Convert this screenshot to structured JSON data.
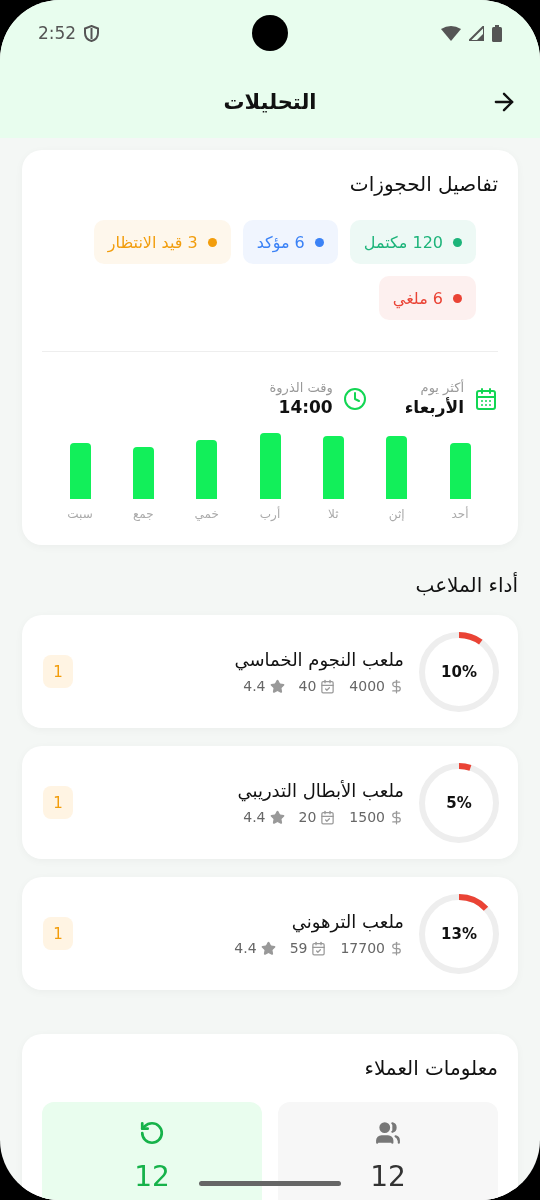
{
  "status_bar": {
    "time": "2:52"
  },
  "header": {
    "title": "التحليلات"
  },
  "bookings": {
    "title": "تفاصيل الحجوزات",
    "chips": [
      {
        "label": "120 مكتمل",
        "color": "#1db47a"
      },
      {
        "label": "6 مؤكد",
        "color": "#3b82f6"
      },
      {
        "label": "3 قيد الانتظار",
        "color": "#f29d0c"
      },
      {
        "label": "6 ملغي",
        "color": "#ea4335"
      }
    ],
    "stats": [
      {
        "kind": "day",
        "label": "أكثر يوم",
        "value": "الأربعاء"
      },
      {
        "kind": "time",
        "label": "وقت الذروة",
        "value": "14:00"
      }
    ],
    "days": [
      {
        "label": "أحد"
      },
      {
        "label": "إثن"
      },
      {
        "label": "ثلا"
      },
      {
        "label": "أرب"
      },
      {
        "label": "خمي"
      },
      {
        "label": "جمع"
      },
      {
        "label": "سبت"
      }
    ]
  },
  "fields_title": "أداء الملاعب",
  "fields": [
    {
      "name": "ملعب النجوم الخماسي",
      "percent": "10%",
      "price": "4000",
      "bookings": "40",
      "rating": "4.4",
      "rank": "1"
    },
    {
      "name": "ملعب الأبطال التدريبي",
      "percent": "5%",
      "price": "1500",
      "bookings": "20",
      "rating": "4.4",
      "rank": "1"
    },
    {
      "name": "ملعب الترهوني",
      "percent": "13%",
      "price": "17700",
      "bookings": "59",
      "rating": "4.4",
      "rank": "1"
    }
  ],
  "customers": {
    "title": "معلومات العملاء",
    "tiles": [
      {
        "kind": "total",
        "value": "12"
      },
      {
        "kind": "returning",
        "value": "12"
      }
    ]
  }
}
